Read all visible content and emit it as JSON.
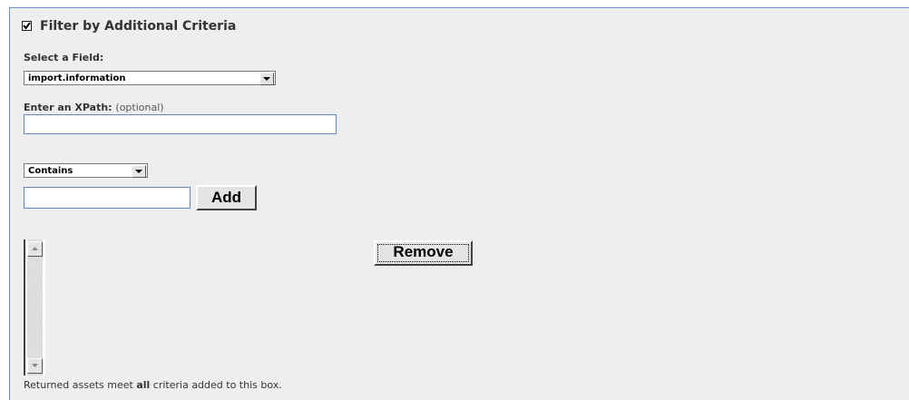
{
  "filter": {
    "checkbox_checked": true,
    "title": "Filter by Additional Criteria"
  },
  "field": {
    "label": "Select a Field:",
    "selected": "import.information"
  },
  "xpath": {
    "label": "Enter an XPath:",
    "optional": "(optional)",
    "value": ""
  },
  "operator": {
    "selected": "Contains"
  },
  "criteria": {
    "value": "",
    "add_label": "Add",
    "remove_label": "Remove"
  },
  "footer": {
    "pre": "Returned assets meet ",
    "bold": "all",
    "post": " criteria added to this box."
  }
}
